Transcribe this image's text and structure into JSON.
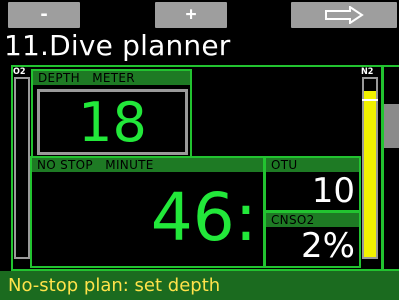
{
  "softkeys": {
    "minus": "-",
    "plus": "+",
    "next_icon": "arrow-right-icon"
  },
  "title": "11.Dive planner",
  "gauges": {
    "o2_label": "O2",
    "n2_label": "N2",
    "n2_level": 0.93
  },
  "depth": {
    "header": "DEPTH   METER",
    "value": "18"
  },
  "no_stop": {
    "header": "NO STOP   MINUTE",
    "value": "46:"
  },
  "otu": {
    "header": "OTU",
    "value": "10"
  },
  "cnso2": {
    "header": "CNSO2",
    "value": "2%"
  },
  "status": "No-stop plan: set depth",
  "colors": {
    "accent": "#22c330",
    "digits": "#22e83a",
    "status_text": "#ffe24a",
    "n2_bar": "#f2f200"
  }
}
